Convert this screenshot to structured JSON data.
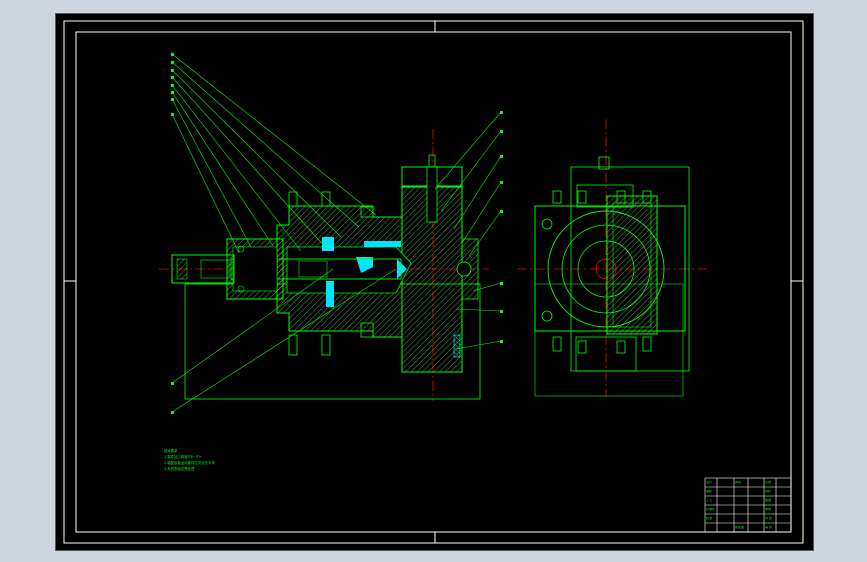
{
  "colors": {
    "background": "#000000",
    "frame": "#ffffff",
    "outline": "#00ff00",
    "centerline": "#ff0000",
    "hatch": "#00ffff",
    "accent_fill": "#00e5ff",
    "title_text": "#00ff00"
  },
  "notes": {
    "title": "技术要求",
    "lines": [
      "1.零件加工精度IT8~IT9",
      "2.装配后各运动部件应灵活无卡滞",
      "3.夹具表面发黑处理"
    ]
  },
  "title_block": {
    "rows": [
      [
        "设计",
        "",
        "夹具",
        "",
        "比例",
        ""
      ],
      [
        "审核",
        "",
        "",
        "",
        "材料",
        ""
      ],
      [
        "工艺",
        "",
        "",
        "",
        "数量",
        ""
      ],
      [
        "标准化",
        "",
        "",
        "",
        "重量",
        ""
      ],
      [
        "批准",
        "",
        "",
        "",
        "共 张",
        ""
      ],
      [
        "",
        "",
        "装配图",
        "",
        "第 张",
        ""
      ]
    ]
  }
}
